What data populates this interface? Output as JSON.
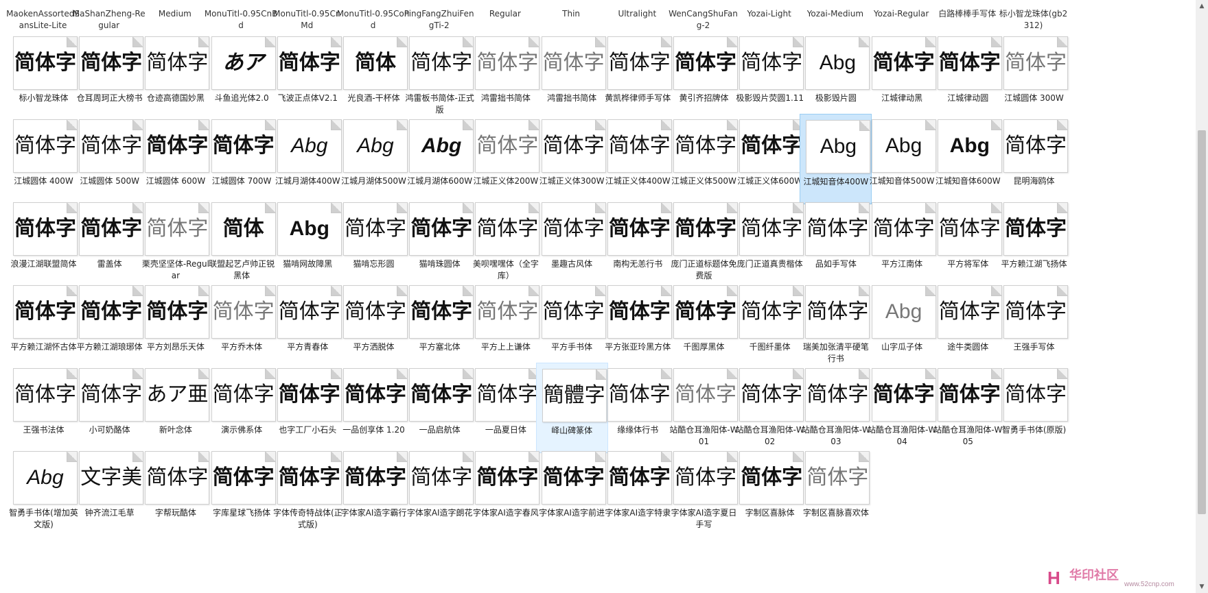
{
  "top_labels": [
    "MaokenAssortedSansLite-Lite",
    "MaShanZheng-Regular",
    "Medium",
    "MonuTitl-0.95CnBd",
    "MonuTitl-0.95CnMd",
    "MonuTitl-0.95Cond",
    "PingFangZhuiFengTi-2",
    "Regular",
    "Thin",
    "Ultralight",
    "WenCangShuFang-2",
    "Yozai-Light",
    "Yozai-Medium",
    "Yozai-Regular",
    "白路棒棒手写体",
    "标小智龙珠体(gb2312)"
  ],
  "rows": [
    [
      {
        "label": "标小智龙珠体",
        "sample": "简体字",
        "style": "bold"
      },
      {
        "label": "仓耳周珂正大榜书",
        "sample": "简体字",
        "style": "bold"
      },
      {
        "label": "仓迹高德国妙黑",
        "sample": "简体字",
        "style": ""
      },
      {
        "label": "斗鱼追光体2.0",
        "sample": "あア",
        "style": "bold italic"
      },
      {
        "label": "飞波正点体V2.1",
        "sample": "简体字",
        "style": "bold"
      },
      {
        "label": "光良酒-干杯体",
        "sample": "简体",
        "style": "bold"
      },
      {
        "label": "鸿雷板书简体-正式版",
        "sample": "简体字",
        "style": ""
      },
      {
        "label": "鸿雷拙书简体",
        "sample": "简体字",
        "style": "light"
      },
      {
        "label": "鸿雷拙书简体",
        "sample": "简体字",
        "style": "light"
      },
      {
        "label": "黄凯桦律师手写体",
        "sample": "简体字",
        "style": ""
      },
      {
        "label": "黄引齐招牌体",
        "sample": "简体字",
        "style": "bold"
      },
      {
        "label": "极影毁片荧圆1.11",
        "sample": "简体字",
        "style": ""
      },
      {
        "label": "极影毁片圆",
        "sample": "Abg",
        "style": "sans"
      },
      {
        "label": "江城律动黑",
        "sample": "简体字",
        "style": "bold"
      },
      {
        "label": "江城律动圆",
        "sample": "简体字",
        "style": "bold"
      },
      {
        "label": "江城圆体 300W",
        "sample": "简体字",
        "style": "light"
      }
    ],
    [
      {
        "label": "江城圆体 400W",
        "sample": "简体字",
        "style": ""
      },
      {
        "label": "江城圆体 500W",
        "sample": "简体字",
        "style": ""
      },
      {
        "label": "江城圆体 600W",
        "sample": "简体字",
        "style": "bold"
      },
      {
        "label": "江城圆体 700W",
        "sample": "简体字",
        "style": "bold"
      },
      {
        "label": "江城月湖体400W",
        "sample": "Abg",
        "style": "sans italic"
      },
      {
        "label": "江城月湖体500W",
        "sample": "Abg",
        "style": "sans italic"
      },
      {
        "label": "江城月湖体600W",
        "sample": "Abg",
        "style": "sans italic bold"
      },
      {
        "label": "江城正义体200W",
        "sample": "简体字",
        "style": "light"
      },
      {
        "label": "江城正义体300W",
        "sample": "简体字",
        "style": ""
      },
      {
        "label": "江城正义体400W",
        "sample": "简体字",
        "style": ""
      },
      {
        "label": "江城正义体500W",
        "sample": "简体字",
        "style": ""
      },
      {
        "label": "江城正义体600W",
        "sample": "简体字",
        "style": "bold"
      },
      {
        "label": "江城知音体400W",
        "sample": "Abg",
        "style": "sans",
        "selected": true
      },
      {
        "label": "江城知音体500W",
        "sample": "Abg",
        "style": "sans"
      },
      {
        "label": "江城知音体600W",
        "sample": "Abg",
        "style": "sans bold"
      },
      {
        "label": "昆明海鸥体",
        "sample": "简体字",
        "style": ""
      }
    ],
    [
      {
        "label": "浪漫江湖联盟简体",
        "sample": "简体字",
        "style": "bold"
      },
      {
        "label": "雷盖体",
        "sample": "简体字",
        "style": "bold"
      },
      {
        "label": "栗壳坚坚体-Regular",
        "sample": "简体字",
        "style": "light"
      },
      {
        "label": "联盟起艺卢帅正锐黑体",
        "sample": "简体",
        "style": "bold"
      },
      {
        "label": "猫啃网故障黑",
        "sample": "Abg",
        "style": "sans bold"
      },
      {
        "label": "猫啃忘形圆",
        "sample": "简体字",
        "style": ""
      },
      {
        "label": "猫啃珠圆体",
        "sample": "简体字",
        "style": "bold"
      },
      {
        "label": "美呗嘿嘿体（全字库）",
        "sample": "简体字",
        "style": ""
      },
      {
        "label": "墨趣古风体",
        "sample": "简体字",
        "style": ""
      },
      {
        "label": "南构无恙行书",
        "sample": "简体字",
        "style": "bold"
      },
      {
        "label": "庞门正道标题体免费版",
        "sample": "简体字",
        "style": "bold"
      },
      {
        "label": "庞门正道真贵楷体",
        "sample": "简体字",
        "style": ""
      },
      {
        "label": "品如手写体",
        "sample": "简体字",
        "style": ""
      },
      {
        "label": "平方江南体",
        "sample": "简体字",
        "style": ""
      },
      {
        "label": "平方将军体",
        "sample": "简体字",
        "style": ""
      },
      {
        "label": "平方赖江湖飞扬体",
        "sample": "简体字",
        "style": "bold"
      }
    ],
    [
      {
        "label": "平方赖江湖怀古体",
        "sample": "简体字",
        "style": "bold"
      },
      {
        "label": "平方赖江湖琅琊体",
        "sample": "简体字",
        "style": "bold"
      },
      {
        "label": "平方刘昂乐天体",
        "sample": "简体字",
        "style": "bold"
      },
      {
        "label": "平方乔木体",
        "sample": "简体字",
        "style": "light"
      },
      {
        "label": "平方青春体",
        "sample": "简体字",
        "style": ""
      },
      {
        "label": "平方洒脱体",
        "sample": "简体字",
        "style": ""
      },
      {
        "label": "平方塞北体",
        "sample": "简体字",
        "style": "bold"
      },
      {
        "label": "平方上上谦体",
        "sample": "简体字",
        "style": "light"
      },
      {
        "label": "平方手书体",
        "sample": "简体字",
        "style": ""
      },
      {
        "label": "平方张亚玲黑方体",
        "sample": "简体字",
        "style": "bold"
      },
      {
        "label": "千图厚黑体",
        "sample": "简体字",
        "style": "bold"
      },
      {
        "label": "千图纤墨体",
        "sample": "简体字",
        "style": ""
      },
      {
        "label": "瑞美加张清平硬笔行书",
        "sample": "简体字",
        "style": ""
      },
      {
        "label": "山字瓜子体",
        "sample": "Abg",
        "style": "sans light"
      },
      {
        "label": "途牛类圆体",
        "sample": "简体字",
        "style": ""
      },
      {
        "label": "王强手写体",
        "sample": "简体字",
        "style": ""
      }
    ],
    [
      {
        "label": "王强书法体",
        "sample": "简体字",
        "style": ""
      },
      {
        "label": "小可奶酪体",
        "sample": "简体字",
        "style": ""
      },
      {
        "label": "新叶念体",
        "sample": "あア亜",
        "style": ""
      },
      {
        "label": "演示佛系体",
        "sample": "简体字",
        "style": ""
      },
      {
        "label": "也字工厂小石头",
        "sample": "简体字",
        "style": "bold"
      },
      {
        "label": "一品创享体 1.20",
        "sample": "简体字",
        "style": "bold"
      },
      {
        "label": "一品启航体",
        "sample": "简体字",
        "style": "bold"
      },
      {
        "label": "一品夏日体",
        "sample": "简体字",
        "style": ""
      },
      {
        "label": "峄山碑篆体",
        "sample": "簡體字",
        "style": "",
        "hover": true
      },
      {
        "label": "缘缘体行书",
        "sample": "简体字",
        "style": ""
      },
      {
        "label": "站酷仓耳渔阳体-W01",
        "sample": "简体字",
        "style": "light"
      },
      {
        "label": "站酷仓耳渔阳体-W02",
        "sample": "简体字",
        "style": ""
      },
      {
        "label": "站酷仓耳渔阳体-W03",
        "sample": "简体字",
        "style": ""
      },
      {
        "label": "站酷仓耳渔阳体-W04",
        "sample": "简体字",
        "style": "bold"
      },
      {
        "label": "站酷仓耳渔阳体-W05",
        "sample": "简体字",
        "style": "bold"
      },
      {
        "label": "智勇手书体(原版)",
        "sample": "简体字",
        "style": ""
      }
    ],
    [
      {
        "label": "智勇手书体(增加英文版)",
        "sample": "Abg",
        "style": "sans italic"
      },
      {
        "label": "钟齐流江毛草",
        "sample": "文字美",
        "style": ""
      },
      {
        "label": "字帮玩酷体",
        "sample": "简体字",
        "style": ""
      },
      {
        "label": "字库星球飞扬体",
        "sample": "简体字",
        "style": "bold"
      },
      {
        "label": "字体传奇特战体(正式版)",
        "sample": "简体字",
        "style": "bold"
      },
      {
        "label": "字体家AI造字霸行",
        "sample": "简体字",
        "style": "bold"
      },
      {
        "label": "字体家AI造字朗花",
        "sample": "简体字",
        "style": ""
      },
      {
        "label": "字体家AI造字春风",
        "sample": "简体字",
        "style": "bold"
      },
      {
        "label": "字体家AI造字前进",
        "sample": "简体字",
        "style": "bold"
      },
      {
        "label": "字体家AI造字特隶",
        "sample": "简体字",
        "style": "bold"
      },
      {
        "label": "字体家AI造字夏日手写",
        "sample": "简体字",
        "style": ""
      },
      {
        "label": "字制区喜脉体",
        "sample": "简体字",
        "style": "bold"
      },
      {
        "label": "字制区喜脉喜欢体",
        "sample": "简体字",
        "style": "light"
      }
    ]
  ],
  "scrollbar": {
    "up": "▲",
    "down": "▼"
  },
  "watermark": {
    "text": "华印社区",
    "url": "www.52cnp.com",
    "icon": "H"
  }
}
